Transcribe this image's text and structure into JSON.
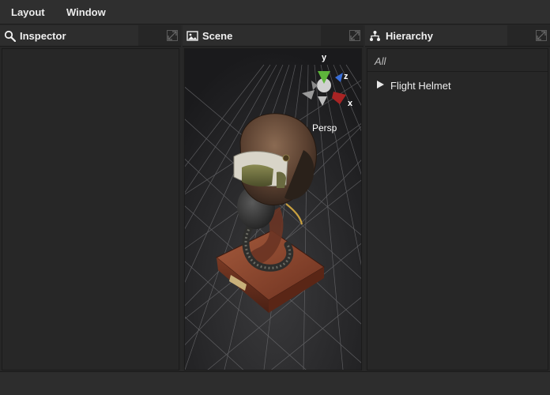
{
  "menu": {
    "items": [
      {
        "label": "Layout"
      },
      {
        "label": "Window"
      }
    ]
  },
  "panels": {
    "inspector": {
      "title": "Inspector",
      "icon": "search-icon"
    },
    "scene": {
      "title": "Scene",
      "icon": "image-icon",
      "gizmo": {
        "x_label": "x",
        "y_label": "y",
        "z_label": "z",
        "projection": "Persp"
      },
      "colors": {
        "x_axis": "#a82424",
        "y_axis": "#5eb53b",
        "z_axis": "#3a6fd9",
        "background": "#1c1c1e"
      }
    },
    "hierarchy": {
      "title": "Hierarchy",
      "icon": "hierarchy-icon",
      "filter": "All",
      "items": [
        {
          "label": "Flight Helmet",
          "expanded": false
        }
      ]
    }
  }
}
